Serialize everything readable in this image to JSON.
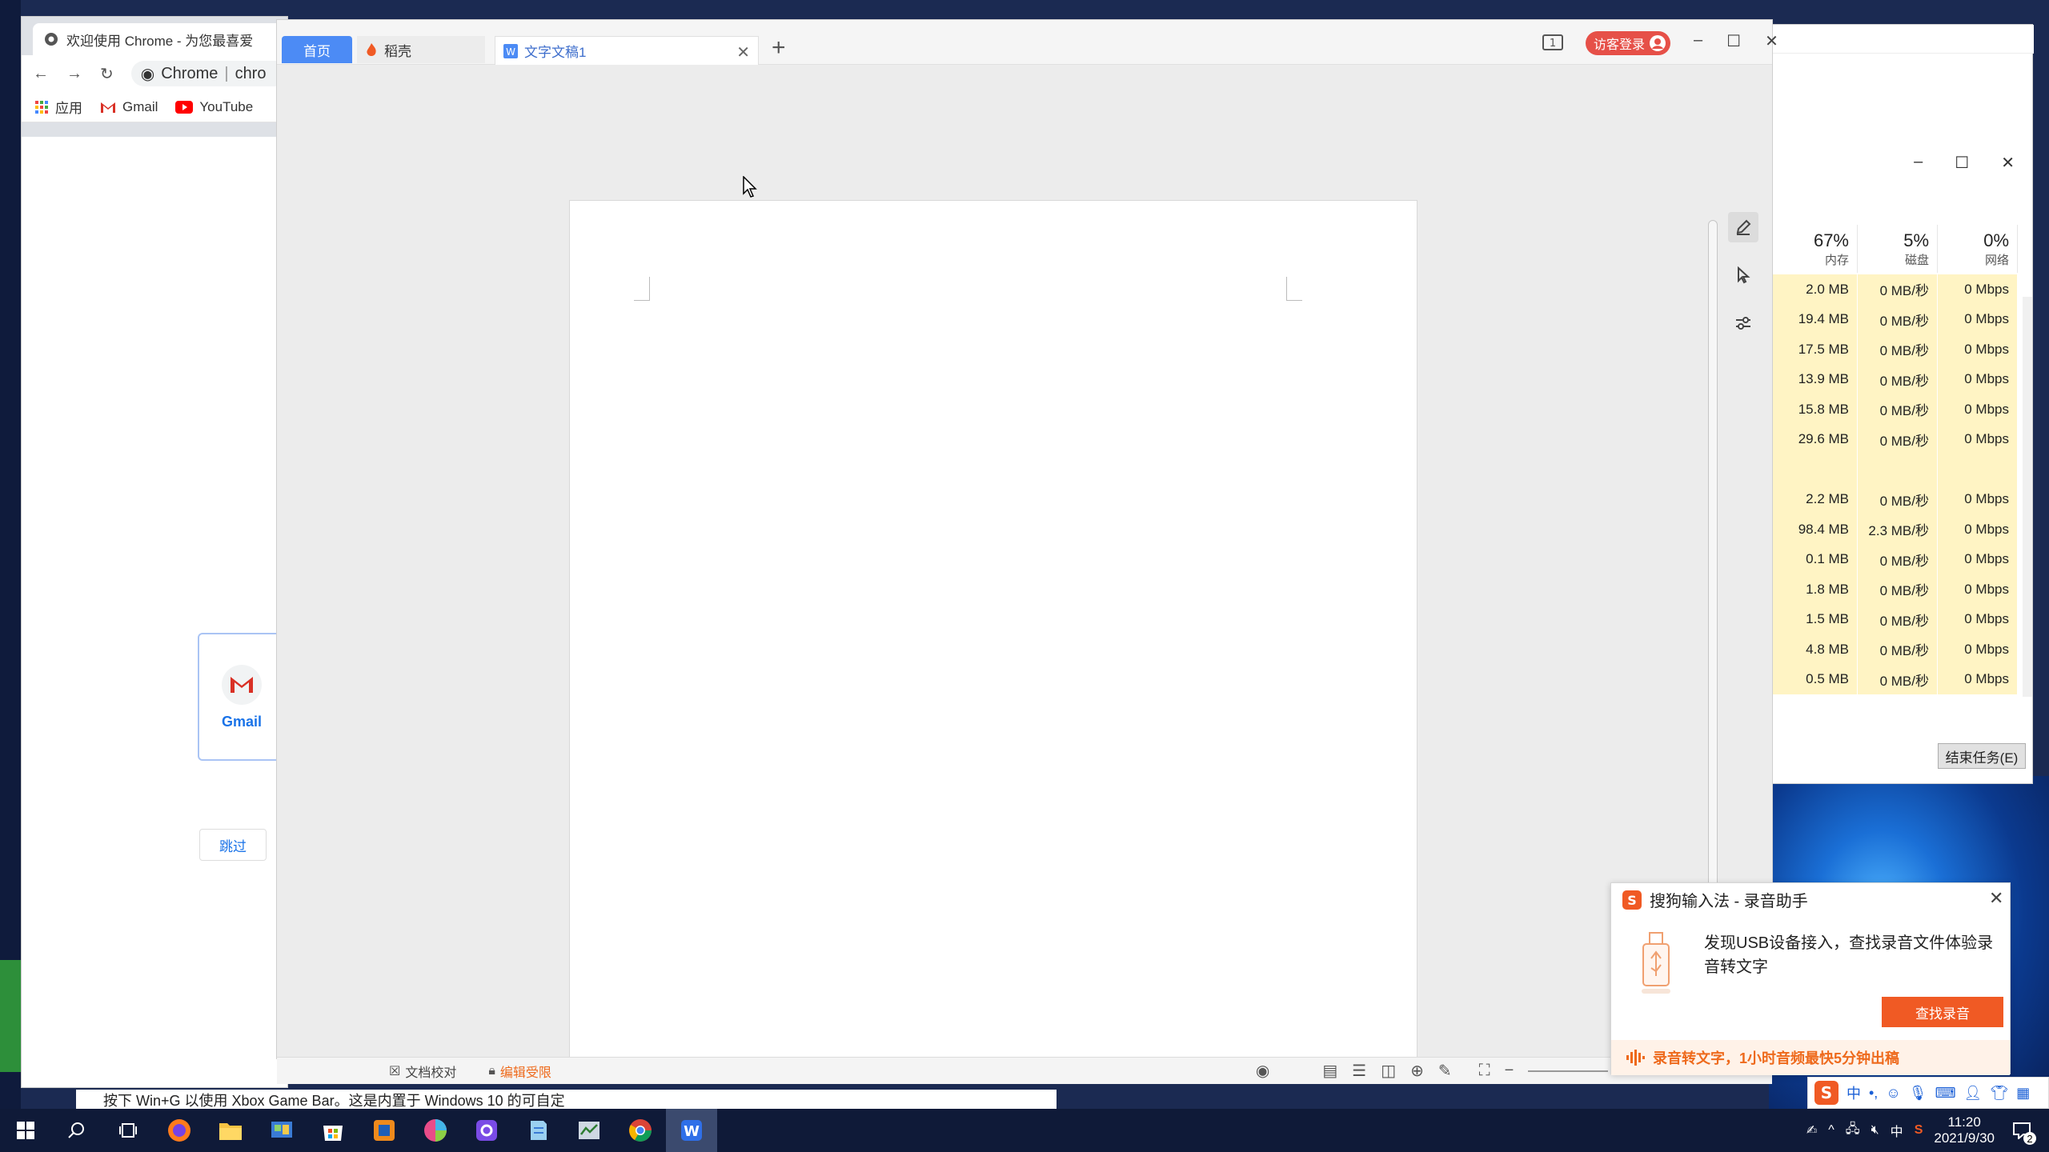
{
  "chrome": {
    "tab_title": "欢迎使用 Chrome - 为您最喜爱",
    "omnibox_label": "Chrome",
    "omnibox_url": "chro",
    "bookmarks": [
      {
        "icon": "apps-grid-icon",
        "label": "应用"
      },
      {
        "icon": "gmail-icon",
        "label": "Gmail"
      },
      {
        "icon": "youtube-icon",
        "label": "YouTube"
      }
    ],
    "gmail_card_label": "Gmail",
    "skip_button": "跳过"
  },
  "wps": {
    "tabs": {
      "home": "首页",
      "daoke": "稻壳",
      "document": "文字文稿1"
    },
    "login_label": "访客登录",
    "status": {
      "proofread": "文档校对",
      "edit_restriction": "编辑受限"
    }
  },
  "task_manager": {
    "headers": [
      {
        "pct": "67%",
        "label": "内存"
      },
      {
        "pct": "5%",
        "label": "磁盘"
      },
      {
        "pct": "0%",
        "label": "网络"
      }
    ],
    "rows": [
      [
        "2.0 MB",
        "0 MB/秒",
        "0 Mbps"
      ],
      [
        "19.4 MB",
        "0 MB/秒",
        "0 Mbps"
      ],
      [
        "17.5 MB",
        "0 MB/秒",
        "0 Mbps"
      ],
      [
        "13.9 MB",
        "0 MB/秒",
        "0 Mbps"
      ],
      [
        "15.8 MB",
        "0 MB/秒",
        "0 Mbps"
      ],
      [
        "29.6 MB",
        "0 MB/秒",
        "0 Mbps"
      ],
      [
        "",
        "",
        ""
      ],
      [
        "2.2 MB",
        "0 MB/秒",
        "0 Mbps"
      ],
      [
        "98.4 MB",
        "2.3 MB/秒",
        "0 Mbps"
      ],
      [
        "0.1 MB",
        "0 MB/秒",
        "0 Mbps"
      ],
      [
        "1.8 MB",
        "0 MB/秒",
        "0 Mbps"
      ],
      [
        "1.5 MB",
        "0 MB/秒",
        "0 Mbps"
      ],
      [
        "4.8 MB",
        "0 MB/秒",
        "0 Mbps"
      ],
      [
        "0.5 MB",
        "0 MB/秒",
        "0 Mbps"
      ]
    ],
    "end_task_button": "结束任务(E)"
  },
  "sogou": {
    "title": "搜狗输入法 - 录音助手",
    "message": "发现USB设备接入，查找录音文件体验录音转文字",
    "button": "查找录音",
    "footer": "录音转文字，1小时音频最快5分钟出稿"
  },
  "notification_text": "按下 Win+G 以使用 Xbox Game Bar。这是内置于 Windows 10 的可自定",
  "taskbar": {
    "ime_lang": "中",
    "time": "11:20",
    "date": "2021/9/30",
    "notification_count": "2"
  },
  "colors": {
    "wps_blue": "#4c8bf5",
    "login_red": "#e65048",
    "sogou_orange": "#f05a24",
    "taskbar": "#0f1a38"
  }
}
